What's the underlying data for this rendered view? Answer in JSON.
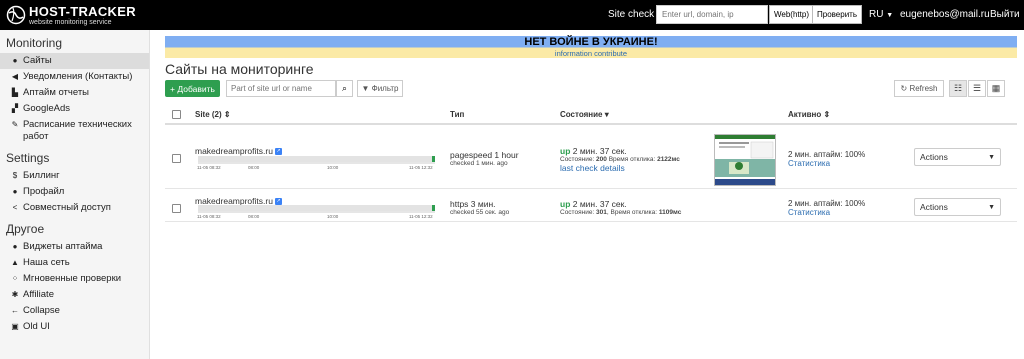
{
  "brand": {
    "title": "HOST-TRACKER",
    "subtitle": "website monitoring service"
  },
  "topbar": {
    "site_check_label": "Site check",
    "site_check_placeholder": "Enter url, domain, ip",
    "method_label": "Web(http)",
    "check_button": "Проверить",
    "lang": "RU",
    "email": "eugenebos@mail.ru",
    "logout": "Выйти"
  },
  "sidebar": {
    "monitoring_title": "Monitoring",
    "monitoring": [
      {
        "label": "Сайты",
        "icon": "globe-icon",
        "active": true
      },
      {
        "label": "Уведомления (Контакты)",
        "icon": "megaphone-icon"
      },
      {
        "label": "Аптайм отчеты",
        "icon": "bar-chart-icon"
      },
      {
        "label": "GoogleAds",
        "icon": "sitemap-icon"
      },
      {
        "label": "Расписание технических работ",
        "icon": "wrench-icon"
      }
    ],
    "settings_title": "Settings",
    "settings": [
      {
        "label": "Биллинг",
        "icon": "dollar-icon"
      },
      {
        "label": "Профайл",
        "icon": "user-icon"
      },
      {
        "label": "Совместный доступ",
        "icon": "share-icon"
      }
    ],
    "other_title": "Другое",
    "other": [
      {
        "label": "Виджеты аптайма",
        "icon": "info-icon"
      },
      {
        "label": "Наша сеть",
        "icon": "network-icon"
      },
      {
        "label": "Мгновенные проверки",
        "icon": "spinner-icon"
      },
      {
        "label": "Affiliate",
        "icon": "gear-icon"
      },
      {
        "label": "Collapse",
        "icon": "arrow-left-icon"
      },
      {
        "label": "Old UI",
        "icon": "window-icon"
      }
    ]
  },
  "banner": {
    "title": "НЕТ ВОЙНЕ В УКРАИНЕ!",
    "link1": "information",
    "link2": "contribute"
  },
  "page": {
    "title": "Сайты на мониторинге",
    "add_button": "Добавить",
    "search_placeholder": "Part of site url or name",
    "filter_button": "Фильтр",
    "refresh_button": "Refresh"
  },
  "table": {
    "headers": {
      "site": "Site (2)",
      "type": "Тип",
      "status": "Состояние",
      "active": "Активно"
    },
    "rows": [
      {
        "site": "makedreamprofits.ru",
        "ticks": [
          "11-05 08:32",
          "08:00",
          "10:00",
          "11-05 12:32"
        ],
        "type": "pagespeed  1 hour",
        "checked": "checked 1 мин. ago",
        "status_word": "up",
        "status_time": " 2 мин. 37 сек.",
        "status_code_label": "Состояние: ",
        "status_code": "200",
        "resp_label": "  Время отклика: ",
        "resp": "2122мс",
        "details": "last check details",
        "active": "2 мин.  аптайм: 100%",
        "stats": "Статистика",
        "actions": "Actions"
      },
      {
        "site": "makedreamprofits.ru",
        "ticks": [
          "11-05 08:32",
          "08:00",
          "10:00",
          "11-05 12:32"
        ],
        "type": "https  3 мин.",
        "checked": "checked 55 сек. ago",
        "status_word": "up",
        "status_time": " 2 мин. 37 сек.",
        "status_code_label": "Состояние: ",
        "status_code": "301",
        "resp_label": ",  Время отклика: ",
        "resp": "1109мс",
        "details": "",
        "active": "2 мин.  аптайм: 100%",
        "stats": "Статистика",
        "actions": "Actions"
      }
    ]
  },
  "colors": {
    "accent": "#2e9e4f",
    "link": "#2b6cb0",
    "banner_blue": "#7faef2",
    "banner_yellow": "#fbeaa6"
  }
}
